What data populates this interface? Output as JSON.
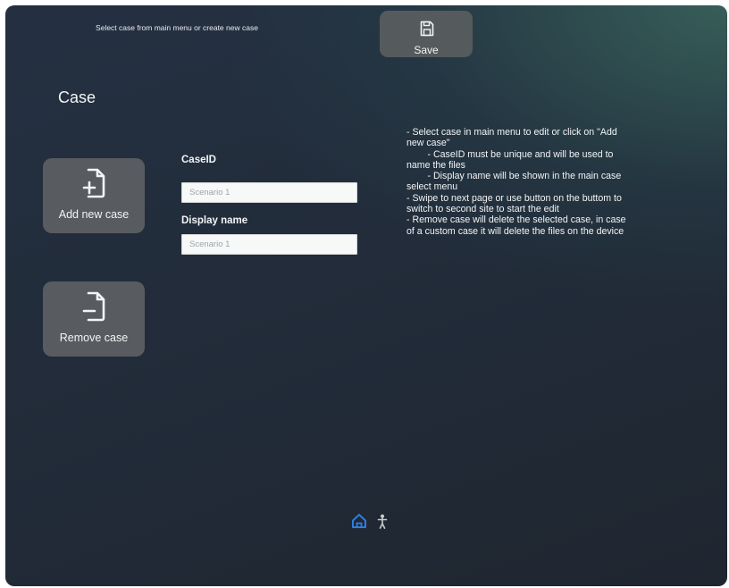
{
  "header": {
    "hint": "Select case from main menu or create new case",
    "save_label": "Save"
  },
  "page": {
    "title": "Case"
  },
  "actions": {
    "add_case_label": "Add new case",
    "remove_case_label": "Remove case"
  },
  "form": {
    "case_id_label": "CaseID",
    "case_id_value": "Scenario 1",
    "display_name_label": "Display name",
    "display_name_value": "Scenario 1"
  },
  "help": {
    "lines": [
      "- Select case in main menu to edit or click on \"Add",
      "new case\"",
      "        - CaseID must be unique and will be used to",
      "name the files",
      "        - Display name will be shown in the main case",
      "select menu",
      "- Swipe to next page or use button on the buttom to",
      "switch to second site to start the edit",
      "- Remove case will delete the selected case, in case",
      "of a custom case it will delete the files on the device"
    ]
  },
  "nav": {
    "items": [
      {
        "icon": "home-icon",
        "active": true,
        "color": "#2f7de0"
      },
      {
        "icon": "person-icon",
        "active": false,
        "color": "#c9cdd0"
      }
    ]
  },
  "colors": {
    "button_bg": "#585c60",
    "text": "#f2f4f5",
    "accent": "#2f7de0"
  }
}
